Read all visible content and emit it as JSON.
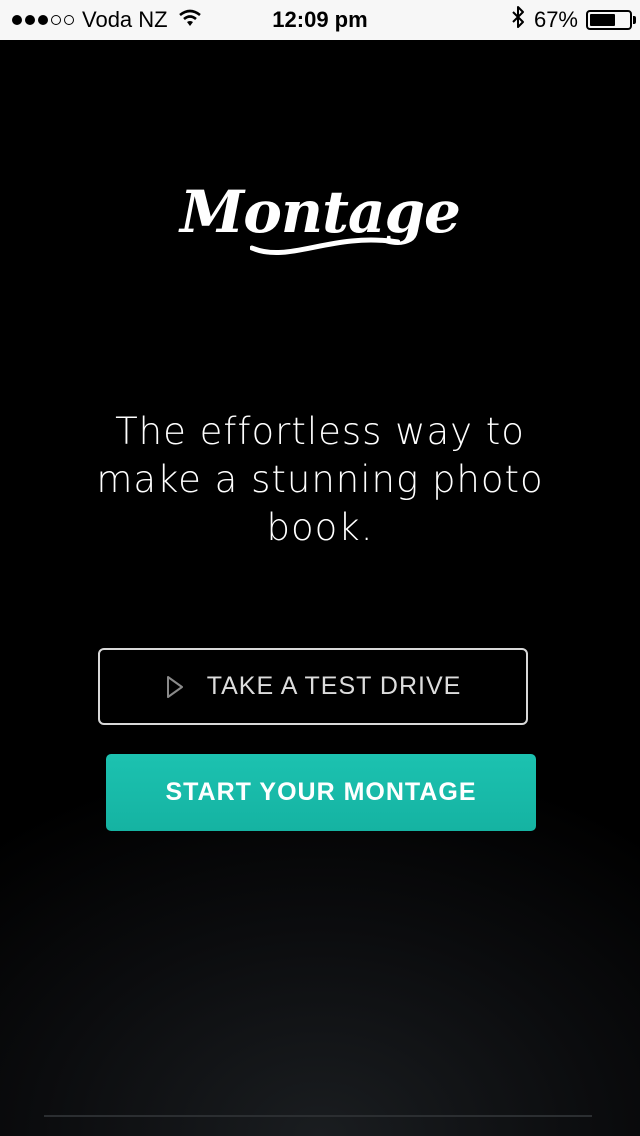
{
  "status_bar": {
    "signal_bars_filled": 3,
    "signal_bars_total": 5,
    "carrier": "Voda NZ",
    "time": "12:09 pm",
    "battery_percent": "67%",
    "battery_level": 0.67,
    "icons": [
      "wifi-icon",
      "bluetooth-icon",
      "battery-icon"
    ]
  },
  "app": {
    "logo_text": "Montage",
    "tagline": "The effortless way to make a stunning photo book.",
    "test_drive_label": "TAKE A TEST DRIVE",
    "start_label": "START YOUR MONTAGE"
  },
  "colors": {
    "background": "#000000",
    "accent": "#17b9a8",
    "status_bar_bg": "#f7f7f7"
  }
}
